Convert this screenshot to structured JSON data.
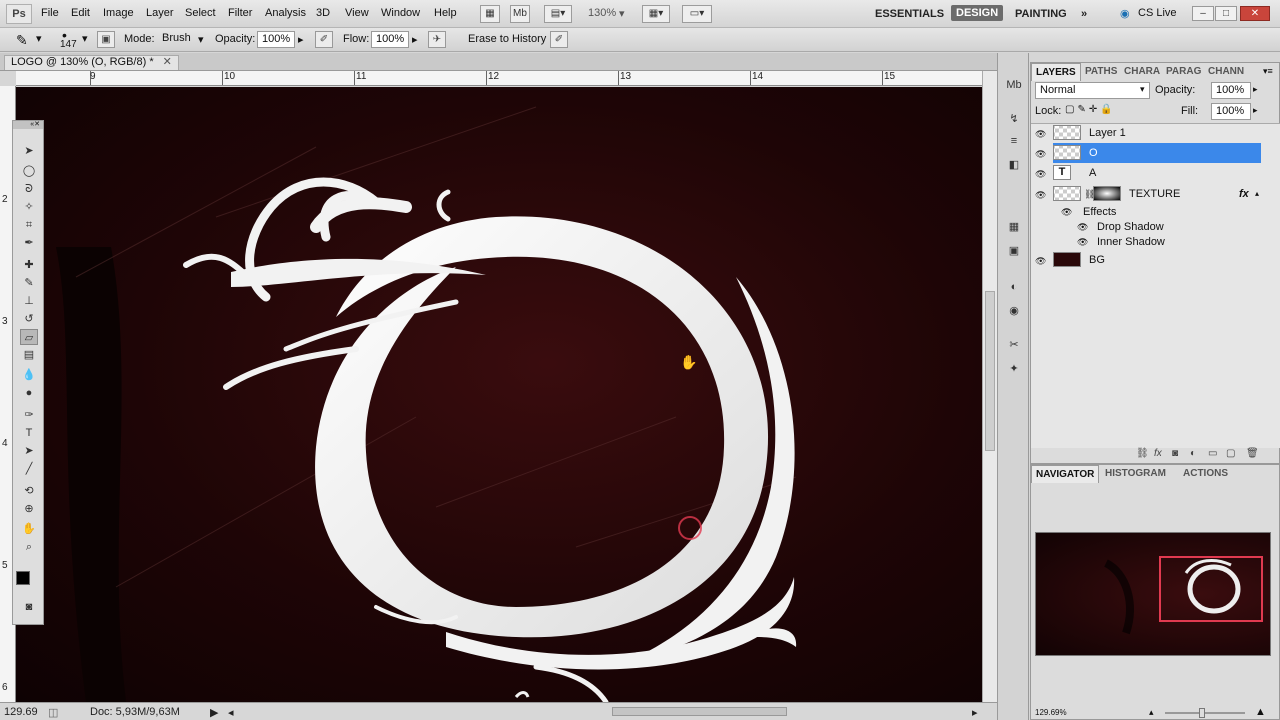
{
  "menubar": {
    "logo": "Ps",
    "items": [
      "File",
      "Edit",
      "Image",
      "Layer",
      "Select",
      "Filter",
      "Analysis",
      "3D",
      "View",
      "Window",
      "Help"
    ],
    "zoom": "130%",
    "workspaces": [
      "ESSENTIALS",
      "DESIGN",
      "PAINTING"
    ],
    "more": "»",
    "cslive": "CS Live"
  },
  "options": {
    "brush_size": "147",
    "mode_label": "Mode:",
    "mode_value": "Brush",
    "opacity_label": "Opacity:",
    "opacity_value": "100%",
    "flow_label": "Flow:",
    "flow_value": "100%",
    "history_label": "Erase to History"
  },
  "document": {
    "tab_title": "LOGO @ 130% (O, RGB/8) *",
    "ruler_h": [
      "9",
      "10",
      "11",
      "12",
      "13",
      "14",
      "15"
    ],
    "ruler_v": [
      "2",
      "3",
      "4",
      "5",
      "6"
    ]
  },
  "status": {
    "zoom": "129.69",
    "doc": "Doc: 5,93M/9,63M"
  },
  "layers_panel": {
    "tabs": [
      "LAYERS",
      "PATHS",
      "CHARA",
      "PARAG",
      "CHANN"
    ],
    "blend_mode": "Normal",
    "opacity_label": "Opacity:",
    "opacity_value": "100%",
    "lock_label": "Lock:",
    "fill_label": "Fill:",
    "fill_value": "100%",
    "layers": [
      {
        "name": "Layer 1",
        "selected": false
      },
      {
        "name": "O",
        "selected": true
      },
      {
        "name": "A",
        "selected": false
      },
      {
        "name": "TEXTURE",
        "selected": false
      },
      {
        "name": "Effects",
        "selected": false
      },
      {
        "name": "Drop Shadow",
        "selected": false
      },
      {
        "name": "Inner Shadow",
        "selected": false
      },
      {
        "name": "BG",
        "selected": false
      }
    ],
    "fx": "fx"
  },
  "navigator": {
    "tabs": [
      "NAVIGATOR",
      "HISTOGRAM",
      "ACTIONS"
    ],
    "zoom": "129.69%"
  },
  "colors": {
    "selection": "#3b88ea",
    "canvas_bg": "#2a0809",
    "accent_red": "#e03a50"
  }
}
